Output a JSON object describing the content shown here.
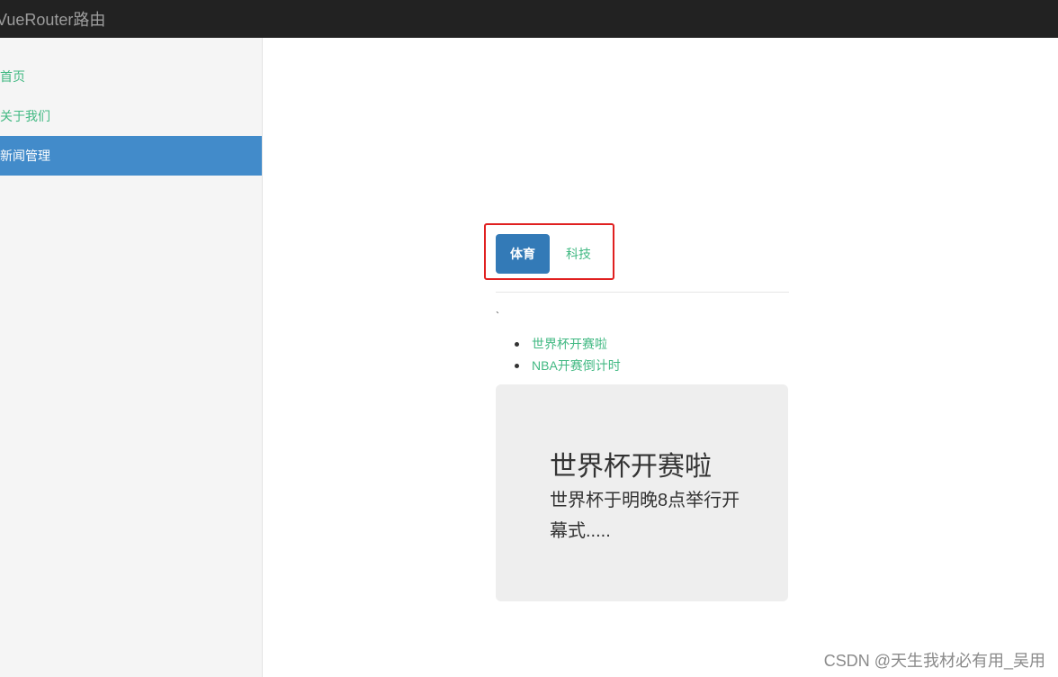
{
  "navbar": {
    "brand": "VueRouter路由"
  },
  "sidebar": {
    "items": [
      {
        "label": "首页",
        "active": false
      },
      {
        "label": "关于我们",
        "active": false
      },
      {
        "label": "新闻管理",
        "active": true
      }
    ]
  },
  "news": {
    "tabs": [
      {
        "label": "体育",
        "active": true
      },
      {
        "label": "科技",
        "active": false
      }
    ],
    "stray_text": "`",
    "list": [
      "世界杯开赛啦",
      "NBA开赛倒计时"
    ],
    "detail": {
      "title": "世界杯开赛啦",
      "body": "世界杯于明晚8点举行开幕式....."
    }
  },
  "watermark": "CSDN @天生我材必有用_吴用",
  "colors": {
    "link": "#42b983",
    "active_nav": "#428bca",
    "active_tab": "#337ab7",
    "highlight_box": "#e02020"
  }
}
